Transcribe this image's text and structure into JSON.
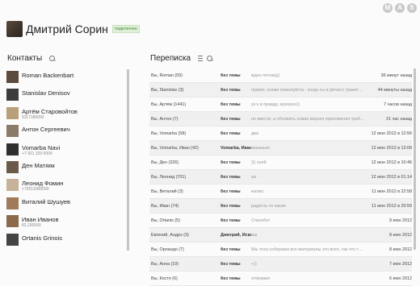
{
  "window": {
    "controls": [
      "M",
      "A",
      "S"
    ]
  },
  "user": {
    "name": "Дмитрий Сорин",
    "status": "подключен"
  },
  "contacts_panel": {
    "title": "Контакты",
    "items": [
      {
        "name": "Roman Backenbart",
        "phone": ""
      },
      {
        "name": "Stanislav Denisov",
        "phone": ""
      },
      {
        "name": "Артём Старовойтов",
        "phone": "9117180000"
      },
      {
        "name": "Антон Сергеевич",
        "phone": ""
      },
      {
        "name": "Vomarba Navi",
        "phone": "+7 921 329 0000"
      },
      {
        "name": "Ден Матяяк",
        "phone": ""
      },
      {
        "name": "Леонид Фомин",
        "phone": "+79213300000"
      },
      {
        "name": "Виталий Шушуев",
        "phone": ""
      },
      {
        "name": "Иван Иванов",
        "phone": "82,100500"
      },
      {
        "name": "Ortanis Grinois",
        "phone": ""
      }
    ]
  },
  "conversations_panel": {
    "title": "Переписка",
    "rows": [
      {
        "from": "Вы, Roman (59)",
        "subject": "без темы",
        "preview": "жден пятниц))",
        "date": "36 минут назад"
      },
      {
        "from": "Вы, Stanislav (3)",
        "subject": "без темы",
        "preview": "привет, скажи пожалуйста - когда ты и plevecc (кажется ...",
        "date": "44 минуты назад"
      },
      {
        "from": "Вы, Артём (1441)",
        "subject": "без темы",
        "preview": "ук н в правду, мукорно))",
        "date": "7 часов назад"
      },
      {
        "from": "Вы, Антон (7)",
        "subject": "без темы",
        "preview": "не ввести, а обновить новая версия приложения требует для ...",
        "date": "21 час назад"
      },
      {
        "from": "Вы, Vomarba (58)",
        "subject": "без темы",
        "preview": "два",
        "date": "12 июн 2012 в 12:56"
      },
      {
        "from": "Вы, Vomarba, Иван (42)",
        "subject": "Vomarba, Иван",
        "preview": "вааанько",
        "date": "12 июн 2012 в 12:09"
      },
      {
        "from": "Вы, Ден (326)",
        "subject": "без темы",
        "preview": "))) охей",
        "date": "12 июн 2012 в 10:46"
      },
      {
        "from": "Вы, Леонид (701)",
        "subject": "без темы",
        "preview": "аа",
        "date": "12 июн 2012 в 01:14"
      },
      {
        "from": "Вы, Виталий (3)",
        "subject": "без темы",
        "preview": "жалко",
        "date": "11 июн 2012 в 22:58"
      },
      {
        "from": "Вы, Иван (74)",
        "subject": "без темы",
        "preview": "радость-то какая",
        "date": "11 июн 2012 в 20:59"
      },
      {
        "from": "Вы, Ortanis (5)",
        "subject": "без темы",
        "preview": "Спасибо!",
        "date": "9 июн 2012"
      },
      {
        "from": "Евгений, Андрэ (3)",
        "subject": "Дмитрий, Искандер, Ауяна",
        "preview": "аш",
        "date": "8 июн 2012"
      },
      {
        "from": "Вы, Орландо (7)",
        "subject": "без темы",
        "preview": "Мы тоха собираем все материалы это всех, так что точно не з...",
        "date": "8 июн 2012"
      },
      {
        "from": "Вы, Анна (19)",
        "subject": "без темы",
        "preview": "+))",
        "date": "7 июн 2012"
      },
      {
        "from": "Вы, Костя (6)",
        "subject": "без темы",
        "preview": "отправил",
        "date": "6 июн 2012"
      }
    ]
  }
}
